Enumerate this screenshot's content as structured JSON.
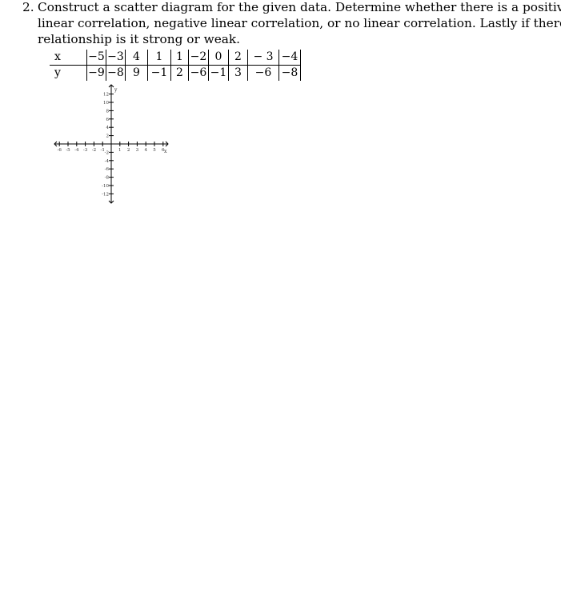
{
  "problem": {
    "number": "2.",
    "lines": [
      "Construct a scatter diagram for the given data. Determine whether there is a positive",
      "linear correlation, negative linear correlation, or no linear correlation.   Lastly if there is a",
      "relationship is it strong or weak."
    ]
  },
  "table": {
    "x_label": "x",
    "y_label": "y",
    "x_values": [
      "−5",
      "−3",
      "4",
      "1",
      "1",
      "−2",
      "0",
      "2",
      "− 3",
      "−4"
    ],
    "y_values": [
      "−9",
      "−8",
      "9",
      "−1",
      "2",
      "−6",
      "−1",
      "3",
      "−6",
      "−8"
    ]
  },
  "graph": {
    "x_axis_label": "x",
    "y_axis_label": "y",
    "x_ticks_neg": [
      "-6",
      "-5",
      "-4",
      "-3",
      "-2",
      "-1"
    ],
    "x_ticks_pos": [
      "1",
      "2",
      "3",
      "4",
      "5",
      "6"
    ],
    "y_ticks_pos": [
      "2",
      "4",
      "6",
      "8",
      "10",
      "12"
    ],
    "y_ticks_neg": [
      "-2",
      "-4",
      "-6",
      "-8",
      "-10",
      "-12"
    ]
  }
}
